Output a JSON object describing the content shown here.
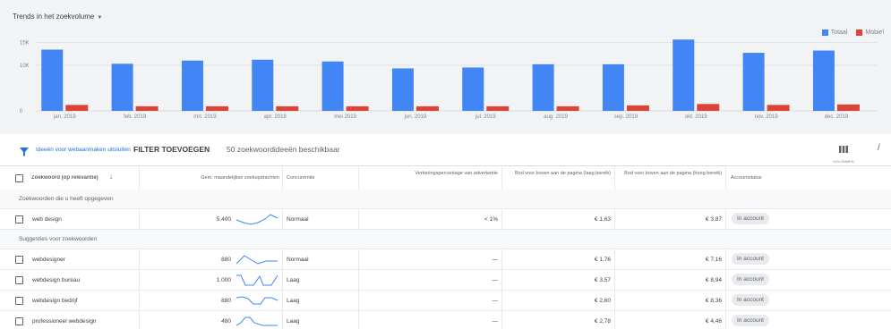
{
  "chart": {
    "dropdown_label": "Trends in het zoekvolume",
    "legend": [
      {
        "name": "Totaal",
        "color": "#4285f4"
      },
      {
        "name": "Mobiel",
        "color": "#db4437"
      }
    ]
  },
  "chart_data": {
    "type": "bar",
    "categories": [
      "jan. 2019",
      "feb. 2019",
      "mrt. 2019",
      "apr. 2019",
      "mei 2019",
      "jun. 2019",
      "jul. 2019",
      "aug. 2019",
      "sep. 2019",
      "okt. 2019",
      "nov. 2019",
      "dec. 2019"
    ],
    "series": [
      {
        "name": "Totaal",
        "values": [
          13400,
          10300,
          11000,
          11200,
          10800,
          9300,
          9500,
          10200,
          10200,
          15600,
          12700,
          13200
        ]
      },
      {
        "name": "Mobiel",
        "values": [
          1300,
          1000,
          1000,
          1000,
          1000,
          1000,
          1000,
          1000,
          1200,
          1500,
          1300,
          1400
        ]
      }
    ],
    "yticks": [
      "15K",
      "10K",
      "0"
    ],
    "ylim": [
      0,
      18000
    ],
    "grid": true,
    "legend_position": "top-right"
  },
  "toolbar": {
    "link_label": "Ideeën voor webaanmaken uitsluiten",
    "filter_label": "FILTER TOEVOEGEN",
    "count_label": "50 zoekwoordideeën beschikbaar",
    "columns_label": "KOLOMMEN"
  },
  "table": {
    "headers": {
      "keyword": "Zoekwoord (op relevantie)",
      "volume": "Gem. maandelijkse zoekopdrachten",
      "competition": "Concurrentie",
      "impression": "Vertoningspercentage van advertentie",
      "bid_low": "Bod voor boven aan de pagina (laag bereik)",
      "bid_high": "Bod voor boven aan de pagina (hoog bereik)",
      "status": "Accountstatus"
    },
    "section_provided": "Zoekwoorden die u heeft opgegeven",
    "section_suggestions": "Suggesties voor zoekwoorden",
    "provided_rows": [
      {
        "keyword": "web design",
        "volume": "5.400",
        "competition": "Normaal",
        "impression": "< 1%",
        "bid_low": "€ 1,63",
        "bid_high": "€ 3,87",
        "status": "In account"
      }
    ],
    "suggestion_rows": [
      {
        "keyword": "webdesigner",
        "volume": "880",
        "competition": "Normaal",
        "impression": "—",
        "bid_low": "€ 1,76",
        "bid_high": "€ 7,16",
        "status": "In account"
      },
      {
        "keyword": "webdesign bureau",
        "volume": "1.000",
        "competition": "Laag",
        "impression": "—",
        "bid_low": "€ 3,57",
        "bid_high": "€ 8,94",
        "status": "In account"
      },
      {
        "keyword": "webdesign bedrijf",
        "volume": "880",
        "competition": "Laag",
        "impression": "—",
        "bid_low": "€ 2,60",
        "bid_high": "€ 8,36",
        "status": "In account"
      },
      {
        "keyword": "professioneel webdesign",
        "volume": "480",
        "competition": "Laag",
        "impression": "—",
        "bid_low": "€ 2,78",
        "bid_high": "€ 4,46",
        "status": "In account"
      }
    ]
  }
}
